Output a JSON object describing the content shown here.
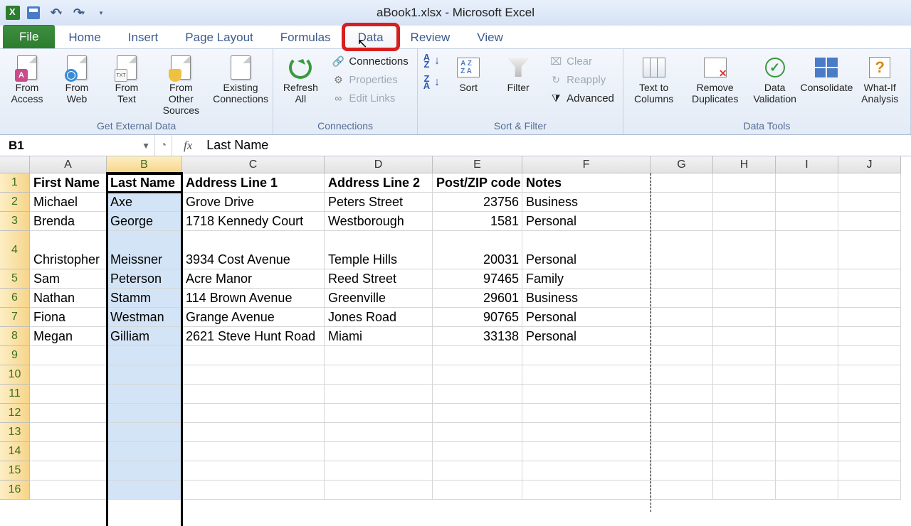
{
  "window": {
    "title": "aBook1.xlsx - Microsoft Excel"
  },
  "tabs": {
    "file": "File",
    "home": "Home",
    "insert": "Insert",
    "page_layout": "Page Layout",
    "formulas": "Formulas",
    "data": "Data",
    "review": "Review",
    "view": "View"
  },
  "ribbon": {
    "get_external": {
      "label": "Get External Data",
      "from_access": "From\nAccess",
      "from_web": "From\nWeb",
      "from_text": "From\nText",
      "from_other": "From Other\nSources",
      "existing": "Existing\nConnections"
    },
    "connections": {
      "label": "Connections",
      "refresh": "Refresh\nAll",
      "connections": "Connections",
      "properties": "Properties",
      "edit_links": "Edit Links"
    },
    "sort_filter": {
      "label": "Sort & Filter",
      "sort": "Sort",
      "filter": "Filter",
      "clear": "Clear",
      "reapply": "Reapply",
      "advanced": "Advanced"
    },
    "data_tools": {
      "label": "Data Tools",
      "text_to_columns": "Text to\nColumns",
      "remove_duplicates": "Remove\nDuplicates",
      "data_validation": "Data\nValidation",
      "consolidate": "Consolidate",
      "what_if": "What-If\nAnalysis"
    }
  },
  "formula_bar": {
    "name_box": "B1",
    "fx": "fx",
    "content": "Last Name"
  },
  "columns": [
    "A",
    "B",
    "C",
    "D",
    "E",
    "F",
    "G",
    "H",
    "I",
    "J"
  ],
  "selected_column": "B",
  "chart_data": {
    "type": "table",
    "headers": [
      "First Name",
      "Last Name",
      "Address Line 1",
      "Address Line 2",
      "Post/ZIP code",
      "Notes"
    ],
    "rows": [
      {
        "first": "Michael",
        "last": "Axe",
        "addr1": "Grove Drive",
        "addr2": "Peters Street",
        "zip": "23756",
        "notes": "Business"
      },
      {
        "first": "Brenda",
        "last": "George",
        "addr1": "1718 Kennedy Court",
        "addr2": "Westborough",
        "zip": "1581",
        "notes": "Personal"
      },
      {
        "first": "Christopher",
        "last": "Meissner",
        "addr1": "3934 Cost Avenue",
        "addr2": "Temple Hills",
        "zip": "20031",
        "notes": "Personal"
      },
      {
        "first": "Sam",
        "last": "Peterson",
        "addr1": "Acre Manor",
        "addr2": "Reed Street",
        "zip": "97465",
        "notes": "Family"
      },
      {
        "first": "Nathan",
        "last": "Stamm",
        "addr1": "114 Brown Avenue",
        "addr2": "Greenville",
        "zip": "29601",
        "notes": "Business"
      },
      {
        "first": "Fiona",
        "last": "Westman",
        "addr1": "Grange Avenue",
        "addr2": "Jones Road",
        "zip": "90765",
        "notes": "Personal"
      },
      {
        "first": "Megan",
        "last": "Gilliam",
        "addr1": "2621 Steve Hunt Road",
        "addr2": "Miami",
        "zip": "33138",
        "notes": "Personal"
      }
    ]
  },
  "empty_rows": [
    9,
    10,
    11,
    12,
    13,
    14,
    15,
    16
  ]
}
